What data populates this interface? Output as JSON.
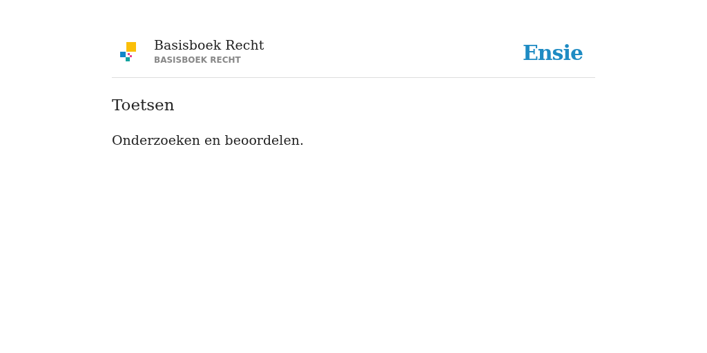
{
  "header": {
    "title": "Basisboek Recht",
    "subtitle": "BASISBOEK RECHT",
    "brand": "Ensie"
  },
  "heading": "Toetsen",
  "body": "Onderzoeken en beoordelen."
}
